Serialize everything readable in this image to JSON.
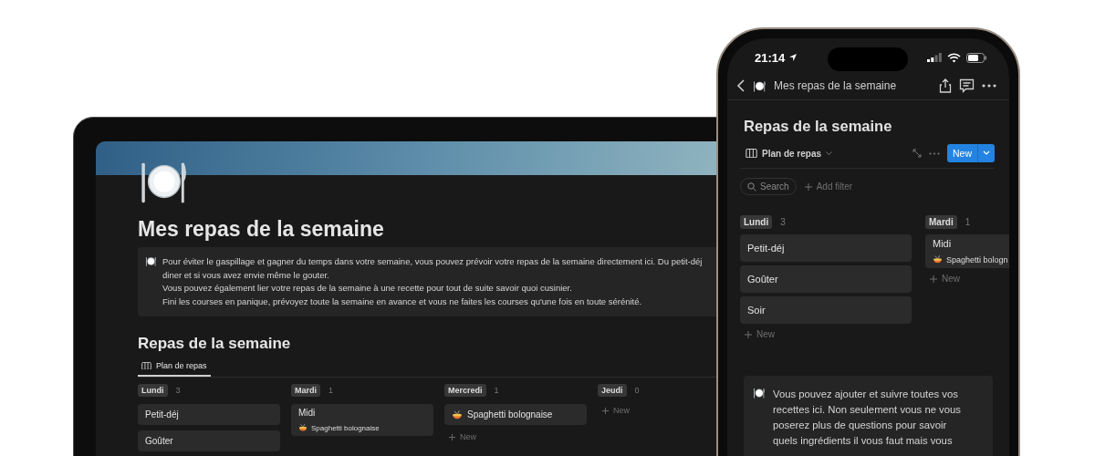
{
  "laptop": {
    "page": {
      "title": "Mes repas de la semaine",
      "callout": [
        "Pour éviter le gaspillage et gagner du temps dans votre semaine, vous pouvez prévoir votre repas de la semaine directement ici. Du petit-déj",
        "diner et si vous avez envie même le gouter.",
        "Vous pouvez également lier votre repas de la semaine à une recette pour tout de suite savoir quoi cusinier.",
        "Fini les courses en panique, prévoyez toute la semaine en avance et vous ne faites les courses qu'une fois en toute sérénité."
      ],
      "database": {
        "title": "Repas de la semaine",
        "views": [
          {
            "label": "Plan de repas",
            "selected": true
          }
        ],
        "columns": [
          {
            "name": "Lundi",
            "count": "3",
            "cards": [
              {
                "kind": "meal",
                "title": "Petit-déj"
              },
              {
                "kind": "meal",
                "title": "Goûter"
              }
            ]
          },
          {
            "name": "Mardi",
            "count": "1",
            "cards": [
              {
                "kind": "meal",
                "title": "Midi",
                "relation": "Spaghetti bolognaise"
              }
            ]
          },
          {
            "name": "Mercredi",
            "count": "1",
            "cards": [
              {
                "kind": "recipe",
                "title": "Spaghetti bolognaise"
              }
            ],
            "new_label": "New"
          },
          {
            "name": "Jeudi",
            "count": "0",
            "new_label": "New"
          }
        ]
      }
    }
  },
  "phone": {
    "status_bar": {
      "time": "21:14"
    },
    "nav": {
      "title": "Mes repas de la semaine"
    },
    "database": {
      "title": "Repas de la semaine",
      "view": "Plan de repas",
      "new_button": "New",
      "search": "Search",
      "add_filter": "Add filter",
      "columns": [
        {
          "name": "Lundi",
          "count": "3",
          "cards": [
            {
              "kind": "meal",
              "title": "Petit-déj"
            },
            {
              "kind": "meal",
              "title": "Goûter"
            },
            {
              "kind": "meal",
              "title": "Soir"
            }
          ],
          "new_label": "New"
        },
        {
          "name": "Mardi",
          "count": "1",
          "cards": [
            {
              "kind": "meal",
              "title": "Midi",
              "relation": "Spaghetti bologn"
            }
          ],
          "new_label": "New"
        }
      ]
    },
    "callout": "Vous pouvez ajouter et suivre toutes vos recettes ici. Non seulement vous ne vous poserez plus de questions pour savoir quels ingrédients il vous faut mais vous"
  }
}
